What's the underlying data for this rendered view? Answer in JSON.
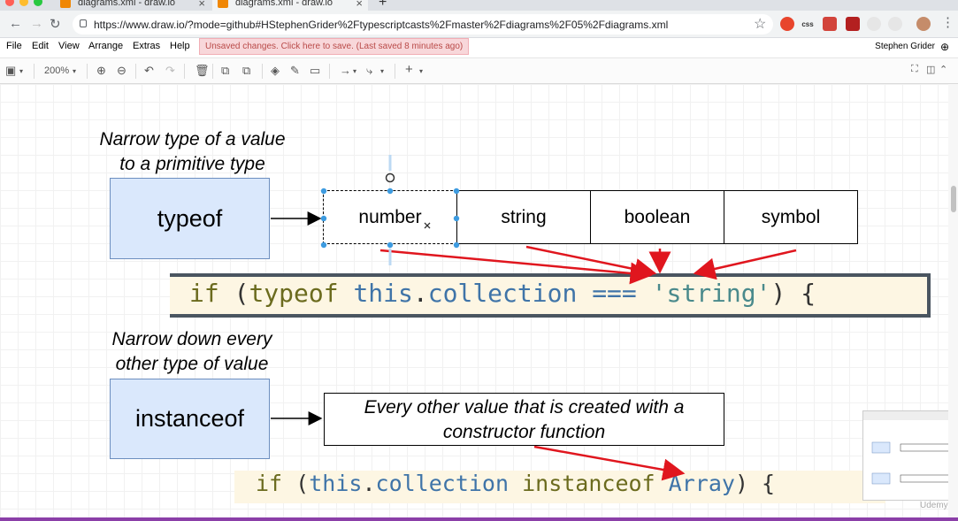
{
  "browser": {
    "tabs": [
      {
        "title": "diagrams.xml - draw.io"
      },
      {
        "title": "diagrams.xml - draw.io"
      }
    ],
    "new_tab": "+",
    "tab_close": "×",
    "url": "https://www.draw.io/?mode=github#HStephenGrider%2Ftypescriptcasts%2Fmaster%2Fdiagrams%2F05%2Fdiagrams.xml",
    "extension_css_label": "css"
  },
  "menubar": {
    "items": [
      "File",
      "Edit",
      "View",
      "Arrange",
      "Extras",
      "Help"
    ],
    "unsaved": "Unsaved changes. Click here to save. (Last saved 8 minutes ago)",
    "user": "Stephen Grider"
  },
  "toolbar": {
    "zoom": "200%"
  },
  "diagram": {
    "heading1_line1": "Narrow type of a value",
    "heading1_line2": "to a primitive type",
    "typeof_label": "typeof",
    "cells": [
      "number",
      "string",
      "boolean",
      "symbol"
    ],
    "heading2_line1": "Narrow down every",
    "heading2_line2": "other type of value",
    "instanceof_label": "instanceof",
    "note_line1": "Every other value that is created with a",
    "note_line2": "constructor function"
  },
  "code1": {
    "if": "if",
    "paren_open": "(",
    "typeof": "typeof",
    "this": "this",
    "dot": ".",
    "collection": "collection",
    "eq": "===",
    "str": "'string'",
    "close": ") {"
  },
  "code2": {
    "if": "if",
    "paren_open": "(",
    "this": "this",
    "dot": ".",
    "collection": "collection",
    "instanceof": "instanceof",
    "array": "Array",
    "close": ") {"
  },
  "watermark": "Udemy",
  "colors": {
    "accent_arrow": "#e0161e",
    "blue_fill": "#dae8fc",
    "selection": "#3d9be0"
  }
}
